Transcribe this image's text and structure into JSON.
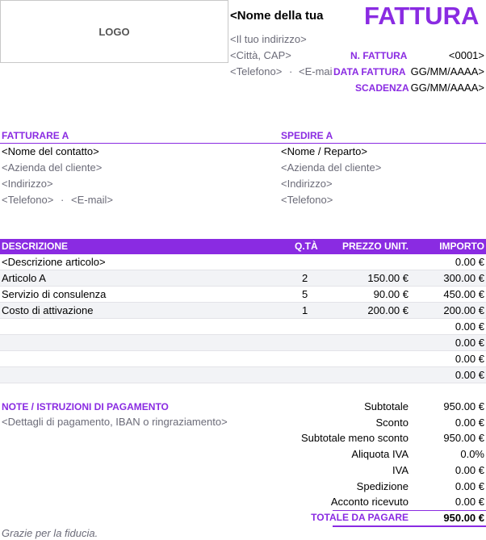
{
  "header": {
    "logo": "LOGO",
    "company_name": "<Nome della tua",
    "title": "FATTURA",
    "address": "<Il tuo indirizzo>",
    "city": "<Città, CAP>",
    "phone": "<Telefono>",
    "dot": "·",
    "email": "<E-mai"
  },
  "meta": {
    "invoice_no_label": "N. FATTURA",
    "invoice_no": "<0001>",
    "date_label": "DATA FATTURA",
    "date": "GG/MM/AAAA>",
    "due_label": "SCADENZA",
    "due": "GG/MM/AAAA>"
  },
  "bill_to": {
    "label": "FATTURARE A",
    "contact": "<Nome del contatto>",
    "company": "<Azienda del cliente>",
    "address": "<Indirizzo>",
    "phone": "<Telefono>",
    "dot": "·",
    "email": "<E-mail>"
  },
  "ship_to": {
    "label": "SPEDIRE A",
    "name": "<Nome / Reparto>",
    "company": "<Azienda del cliente>",
    "address": "<Indirizzo>",
    "phone": "<Telefono>"
  },
  "table": {
    "headers": {
      "desc": "DESCRIZIONE",
      "qty": "Q.TÀ",
      "price": "PREZZO UNIT.",
      "amount": "IMPORTO"
    },
    "rows": [
      {
        "desc": "<Descrizione articolo>",
        "qty": "",
        "price": "",
        "amount": "0.00 €"
      },
      {
        "desc": "Articolo A",
        "qty": "2",
        "price": "150.00 €",
        "amount": "300.00 €"
      },
      {
        "desc": "Servizio di consulenza",
        "qty": "5",
        "price": "90.00 €",
        "amount": "450.00 €"
      },
      {
        "desc": "Costo di attivazione",
        "qty": "1",
        "price": "200.00 €",
        "amount": "200.00 €"
      },
      {
        "desc": "",
        "qty": "",
        "price": "",
        "amount": "0.00 €"
      },
      {
        "desc": "",
        "qty": "",
        "price": "",
        "amount": "0.00 €"
      },
      {
        "desc": "",
        "qty": "",
        "price": "",
        "amount": "0.00 €"
      },
      {
        "desc": "",
        "qty": "",
        "price": "",
        "amount": "0.00 €"
      }
    ]
  },
  "notes": {
    "label": "NOTE / ISTRUZIONI DI PAGAMENTO",
    "text": "<Dettagli di pagamento, IBAN o ringraziamento>"
  },
  "totals": [
    {
      "label": "Subtotale",
      "value": "950.00 €"
    },
    {
      "label": "Sconto",
      "value": "0.00 €"
    },
    {
      "label": "Subtotale meno sconto",
      "value": "950.00 €"
    },
    {
      "label": "Aliquota IVA",
      "value": "0.0%"
    },
    {
      "label": "IVA",
      "value": "0.00 €"
    },
    {
      "label": "Spedizione",
      "value": "0.00 €"
    },
    {
      "label": "Acconto ricevuto",
      "value": "0.00 €"
    }
  ],
  "grand_total": {
    "label": "TOTALE DA PAGARE",
    "value": "950.00 €"
  },
  "footer": {
    "thanks": "Grazie per la fiducia."
  },
  "colors": {
    "accent": "#8a2be2",
    "muted_text": "#6b6b78",
    "alt_row": "#f2f3f6"
  }
}
